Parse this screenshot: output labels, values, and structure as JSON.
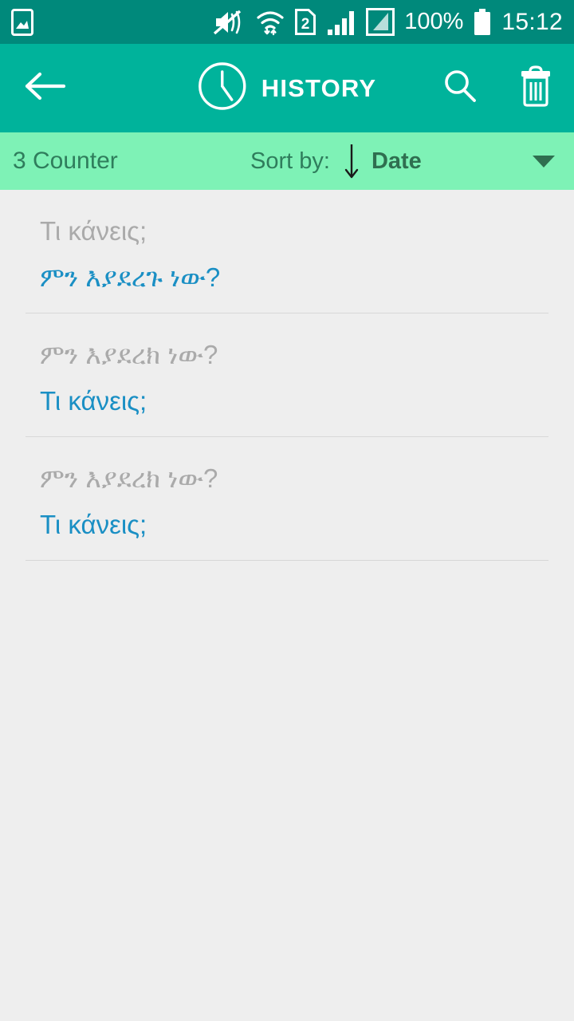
{
  "status_bar": {
    "icons": [
      "gallery-icon",
      "sound-mute-icon",
      "wifi-icon",
      "sim2-icon",
      "signal-icon",
      "signal-secondary-icon"
    ],
    "battery_percent": "100%",
    "time": "15:12"
  },
  "app_bar": {
    "back_label": "back-arrow",
    "clock_label": "clock-icon",
    "title": "HISTORY",
    "search_label": "search-icon",
    "delete_label": "delete-icon"
  },
  "sort_bar": {
    "counter": "3 Counter",
    "sort_label": "Sort by:",
    "sort_direction": "descending",
    "sort_value": "Date",
    "caret": "dropdown-caret"
  },
  "history": {
    "items": [
      {
        "source": "Τι κάνεις;",
        "target": "ምን እያደረጉ ነው?"
      },
      {
        "source": "ምን እያደረክ ነው?",
        "target": "Τι κάνεις;"
      },
      {
        "source": "ምን እያደረክ ነው?",
        "target": "Τι κάνεις;"
      }
    ]
  },
  "colors": {
    "status_bar": "#00897b",
    "app_bar": "#00b39b",
    "sort_bar": "#7ef2b6",
    "body": "#eeeeee",
    "source_text": "#aaaaaa",
    "target_text": "#1a8fc4",
    "sort_text": "#2f7d5c",
    "divider": "#d7d7d7"
  }
}
